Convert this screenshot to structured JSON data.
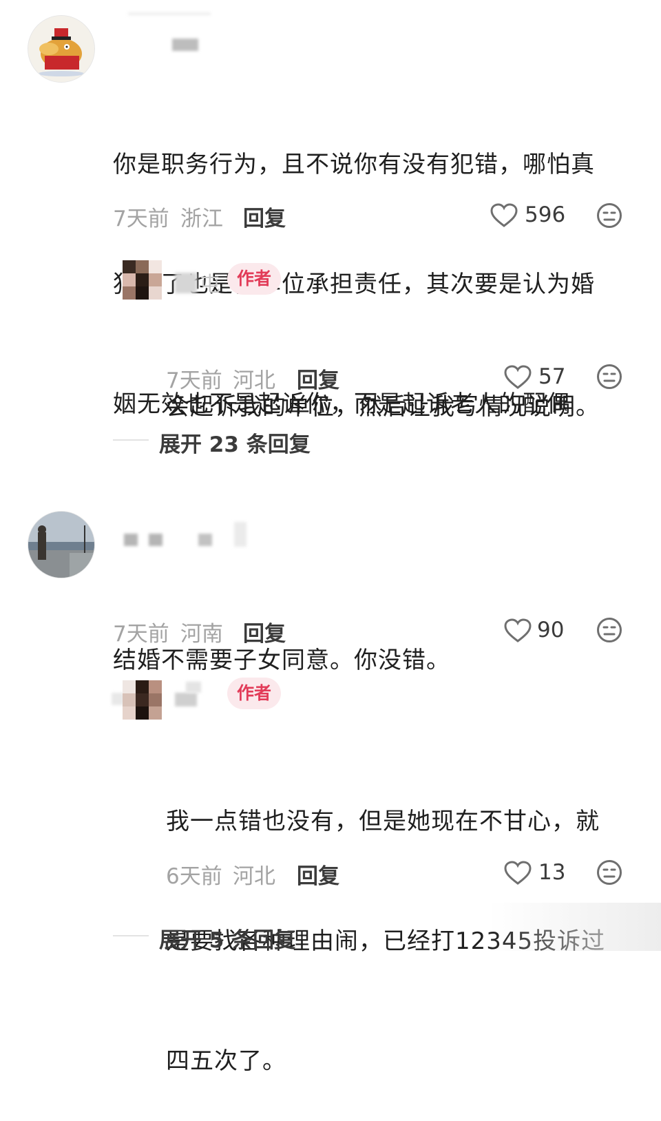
{
  "comments": [
    {
      "text_lines": [
        "你是职务行为，且不说你有没有犯错，哪怕真",
        "犯错了也是你单位承担责任，其次要是认为婚",
        "姻无效也不是起诉你，而是起诉老人的配偶"
      ],
      "time": "7天前",
      "location": "浙江",
      "reply_label": "回复",
      "likes": "596",
      "reply": {
        "name_fragment": "屯",
        "badge": "作者",
        "text_lines": [
          "会起诉我的单位，然后让我写情况说明。"
        ],
        "time": "7天前",
        "location": "河北",
        "reply_label": "回复",
        "likes": "57"
      },
      "expand": "展开 23 条回复"
    },
    {
      "text_lines": [
        "结婚不需要子女同意。你没错。"
      ],
      "time": "7天前",
      "location": "河南",
      "reply_label": "回复",
      "likes": "90",
      "reply": {
        "badge": "作者",
        "text_lines": [
          "我一点错也没有，但是她现在不甘心，就",
          "是要找各种理由闹，已经打12345投诉过",
          "四五次了。"
        ],
        "time": "6天前",
        "location": "河北",
        "reply_label": "回复",
        "likes": "13"
      },
      "expand": "展开 5 条回复"
    }
  ],
  "icons": {
    "like": "heart-outline-icon",
    "emoji": "neutral-face-icon"
  },
  "colors": {
    "author_badge_bg": "#fbe9ec",
    "author_badge_text": "#e23b58",
    "meta": "#a3a3a3"
  }
}
